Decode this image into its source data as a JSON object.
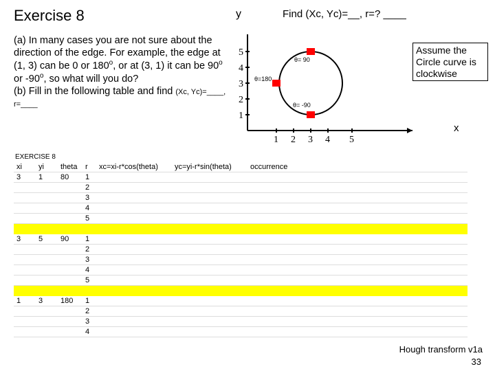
{
  "title": "Exercise 8",
  "ylabel": "y",
  "xlabel": "x",
  "find": "Find (Xc, Yc)=__, r=? ____",
  "body_a": "(a) In many cases you are not sure about the direction of the edge. For example, the edge at (1, 3) can be 0 or 180",
  "body_a2": ",  or at (3, 1) it can be 90",
  "body_a3": " or -90",
  "body_a4": ", so what will you do?",
  "body_b": "(b) Fill in the following table and find ",
  "body_b2": "(Xc, Yc)=____, r=____",
  "deg": "o",
  "assume": "Assume the Circle curve is clockwise",
  "exlabel": "EXERCISE 8",
  "headers": [
    "xi",
    "yi",
    "theta",
    "r",
    "xc=xi-r*cos(theta)",
    "yc=yi-r*sin(theta)",
    "occurrence"
  ],
  "rows": [
    {
      "xi": "3",
      "yi": "1",
      "theta": "80",
      "r": "1",
      "xc": "",
      "yc": "",
      "occ": ""
    },
    {
      "xi": "",
      "yi": "",
      "theta": "",
      "r": "2",
      "xc": "",
      "yc": "",
      "occ": ""
    },
    {
      "xi": "",
      "yi": "",
      "theta": "",
      "r": "3",
      "xc": "",
      "yc": "",
      "occ": ""
    },
    {
      "xi": "",
      "yi": "",
      "theta": "",
      "r": "4",
      "xc": "",
      "yc": "",
      "occ": ""
    },
    {
      "xi": "",
      "yi": "",
      "theta": "",
      "r": "5",
      "xc": "",
      "yc": "",
      "occ": ""
    },
    {
      "xi": "",
      "yi": "",
      "theta": "",
      "r": "",
      "xc": "",
      "yc": "",
      "occ": "",
      "yellow": true
    },
    {
      "xi": "3",
      "yi": "5",
      "theta": "90",
      "r": "1",
      "xc": "",
      "yc": "",
      "occ": ""
    },
    {
      "xi": "",
      "yi": "",
      "theta": "",
      "r": "2",
      "xc": "",
      "yc": "",
      "occ": ""
    },
    {
      "xi": "",
      "yi": "",
      "theta": "",
      "r": "3",
      "xc": "",
      "yc": "",
      "occ": ""
    },
    {
      "xi": "",
      "yi": "",
      "theta": "",
      "r": "4",
      "xc": "",
      "yc": "",
      "occ": ""
    },
    {
      "xi": "",
      "yi": "",
      "theta": "",
      "r": "5",
      "xc": "",
      "yc": "",
      "occ": ""
    },
    {
      "xi": "",
      "yi": "",
      "theta": "",
      "r": "",
      "xc": "",
      "yc": "",
      "occ": "",
      "yellow": true
    },
    {
      "xi": "1",
      "yi": "3",
      "theta": "180",
      "r": "1",
      "xc": "",
      "yc": "",
      "occ": ""
    },
    {
      "xi": "",
      "yi": "",
      "theta": "",
      "r": "2",
      "xc": "",
      "yc": "",
      "occ": ""
    },
    {
      "xi": "",
      "yi": "",
      "theta": "",
      "r": "3",
      "xc": "",
      "yc": "",
      "occ": ""
    },
    {
      "xi": "",
      "yi": "",
      "theta": "",
      "r": "4",
      "xc": "",
      "yc": "",
      "occ": ""
    }
  ],
  "footer": "Hough transform v1a",
  "pagenum": "33",
  "chart_data": {
    "type": "diagram",
    "y_ticks": [
      1,
      2,
      3,
      4,
      5
    ],
    "x_ticks": [
      1,
      2,
      3,
      4,
      5
    ],
    "circle": {
      "cx": 3,
      "cy": 3,
      "r": 2
    },
    "points": [
      {
        "x": 3,
        "y": 5,
        "label": "θ= 90"
      },
      {
        "x": 1,
        "y": 3,
        "label": "θ=180"
      },
      {
        "x": 3,
        "y": 1,
        "label": "θ= -90"
      }
    ]
  }
}
